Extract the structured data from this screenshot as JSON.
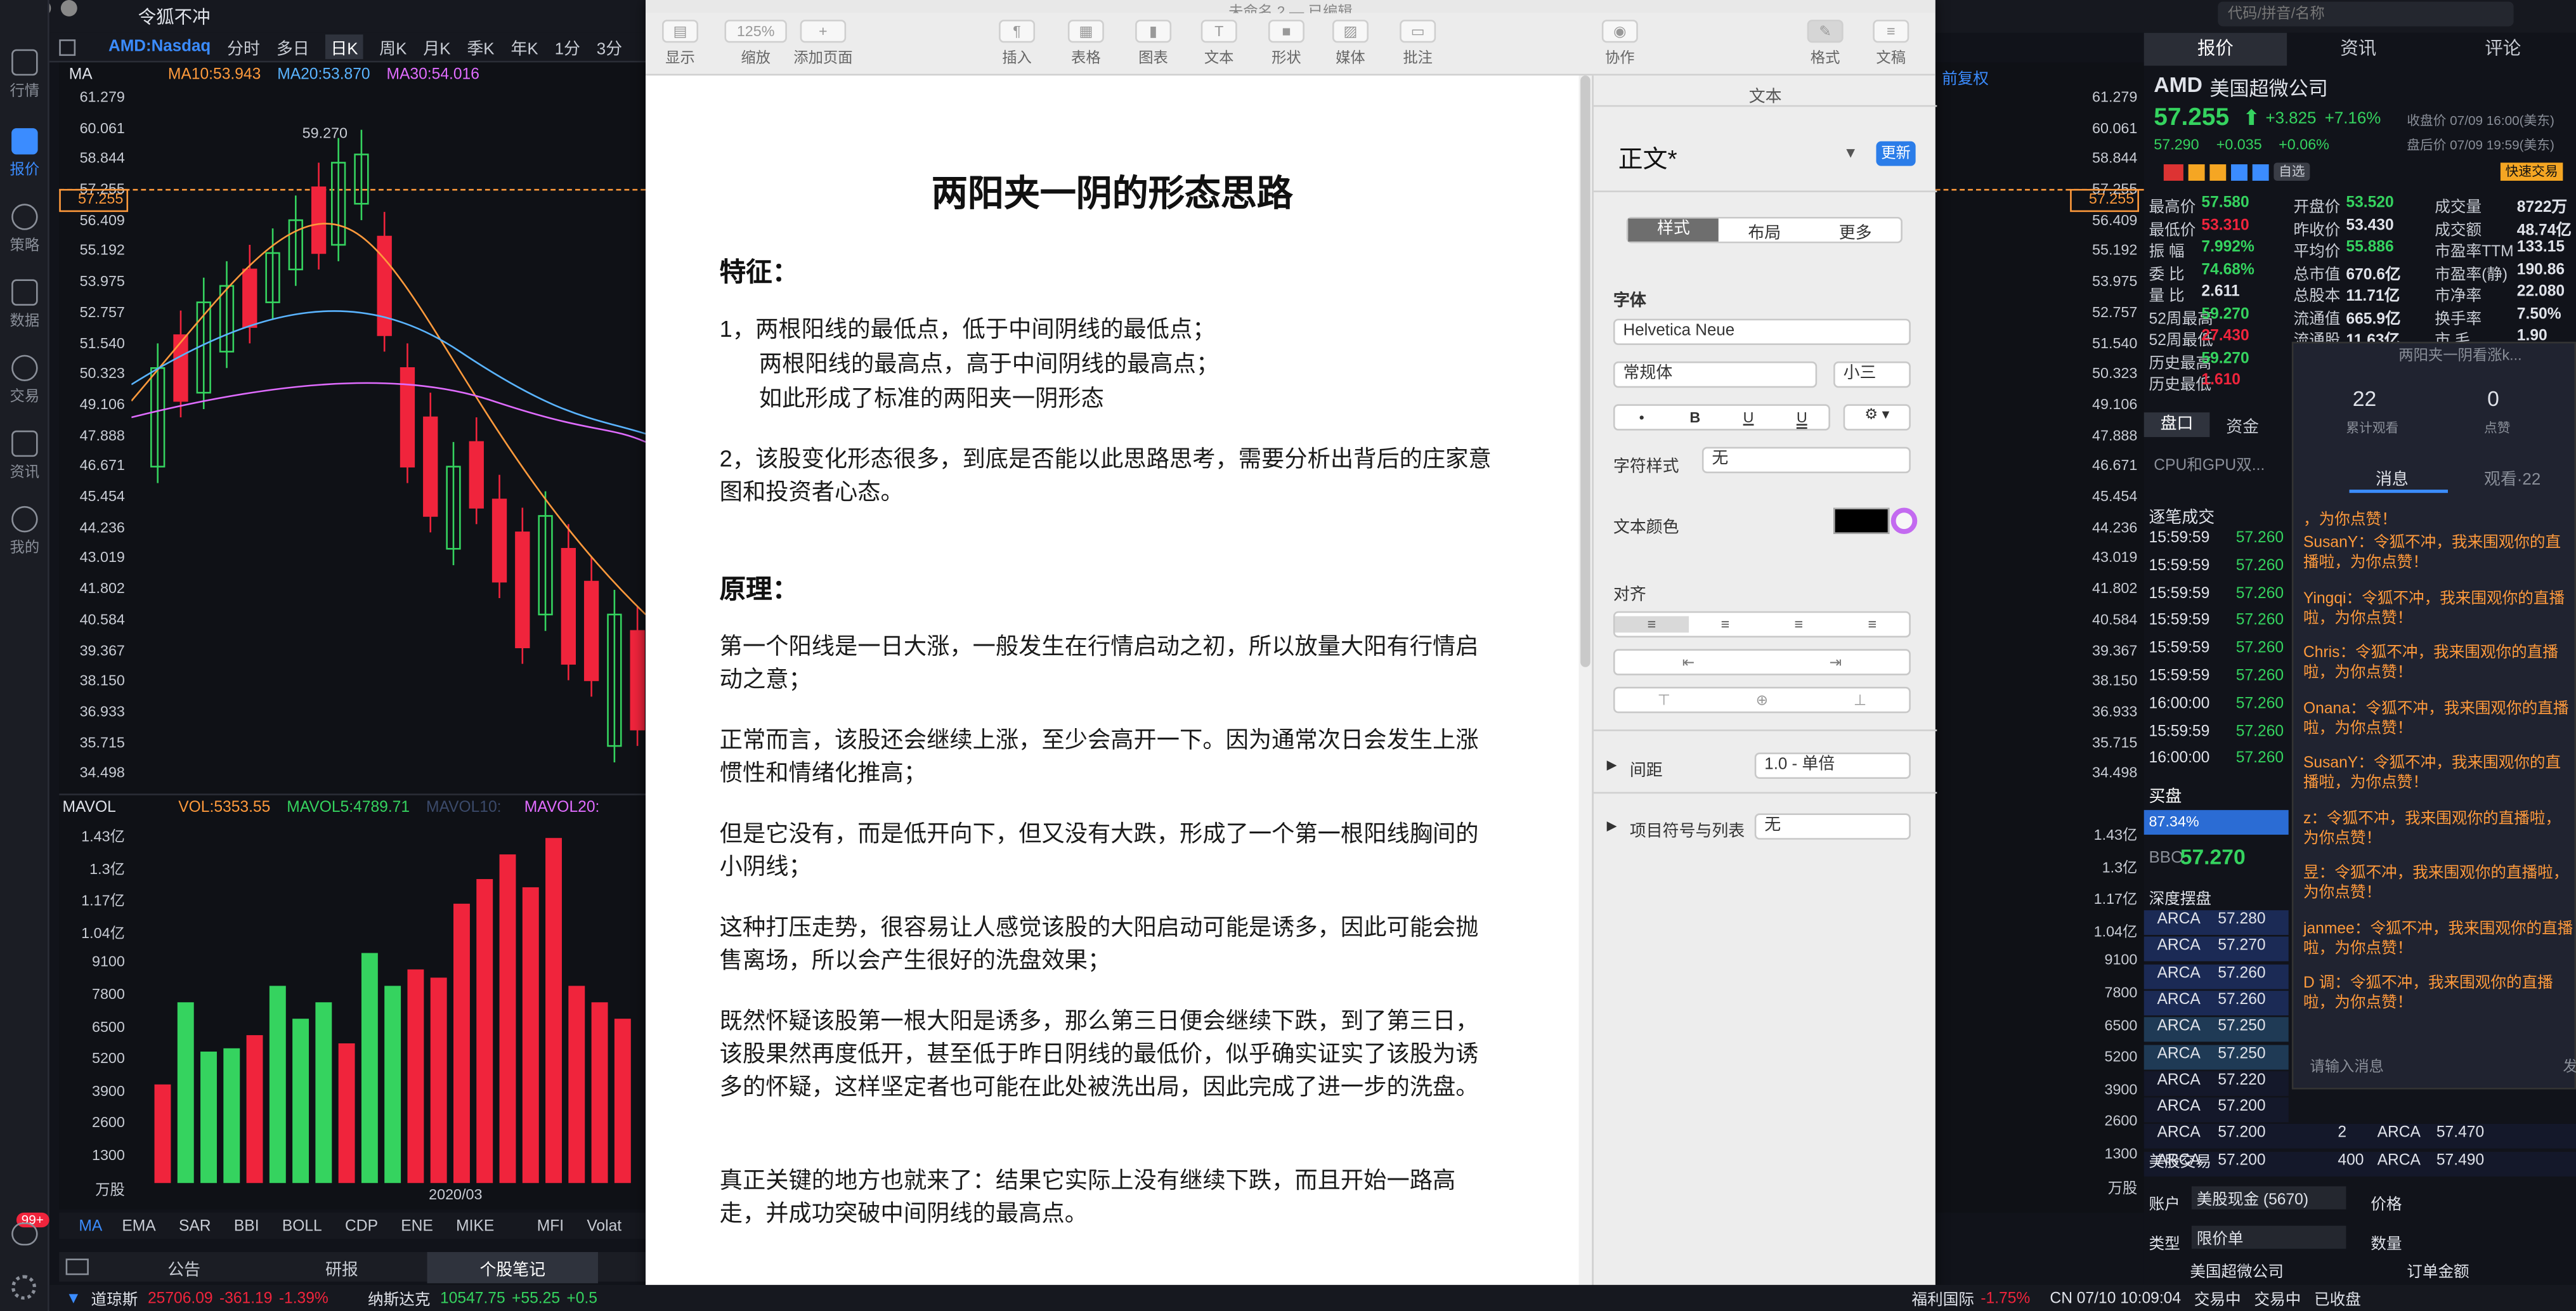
{
  "app": {
    "window_title": "令狐不冲",
    "doc_window_title": "未命名 2 — 已编辑",
    "search_placeholder": "代码/拼音/名称"
  },
  "rail": [
    {
      "label": "行情",
      "icon": "chart-icon"
    },
    {
      "label": "报价",
      "icon": "quote-icon"
    },
    {
      "label": "策略",
      "icon": "strategy-icon"
    },
    {
      "label": "数据",
      "icon": "database-icon"
    },
    {
      "label": "交易",
      "icon": "trade-icon"
    },
    {
      "label": "资讯",
      "icon": "news-icon"
    },
    {
      "label": "我的",
      "icon": "user-icon"
    }
  ],
  "rail_badge": "99+",
  "periods": [
    "AMD:Nasdaq",
    "分时",
    "多日",
    "日K",
    "周K",
    "月K",
    "季K",
    "年K",
    "1分",
    "3分"
  ],
  "ma_line": {
    "label": "MA",
    "ma10": "MA10:53.943",
    "ma20": "MA20:53.870",
    "ma30": "MA30:54.016"
  },
  "y_axis": [
    "61.279",
    "60.061",
    "58.844",
    "57.255",
    "56.409",
    "55.192",
    "53.975",
    "52.757",
    "51.540",
    "50.323",
    "49.106",
    "47.888",
    "46.671",
    "45.454",
    "44.236",
    "43.019",
    "41.802",
    "40.584",
    "39.367",
    "38.150",
    "36.933",
    "35.715",
    "34.498"
  ],
  "peak_label": "59.270",
  "vol_line": {
    "label": "MAVOL",
    "vol": "VOL:5353.55",
    "mavol5": "MAVOL5:4789.71",
    "mavol10": "MAVOL10:",
    "mavol20": "MAVOL20:"
  },
  "vol_axis": [
    "1.43亿",
    "1.3亿",
    "1.17亿",
    "1.04亿",
    "9100",
    "7800",
    "6500",
    "5200",
    "3900",
    "2600",
    "1300",
    "万股"
  ],
  "date_label": "2020/03",
  "indicators": [
    "MA",
    "EMA",
    "SAR",
    "BBI",
    "BOLL",
    "CDP",
    "ENE",
    "MIKE",
    "MFI",
    "Volat"
  ],
  "bottom_tabs": [
    "公告",
    "研报",
    "个股笔记"
  ],
  "toolbar": {
    "display": "显示",
    "zoom_value": "125%",
    "zoom": "缩放",
    "add_page": "添加页面",
    "insert": "插入",
    "table": "表格",
    "chart": "图表",
    "text": "文本",
    "shape": "形状",
    "media": "媒体",
    "comment": "批注",
    "collaborate": "协作",
    "format": "格式",
    "document": "文稿"
  },
  "doc": {
    "title": "两阳夹一阴的形态思路",
    "h_features": "特征：",
    "f1a": "1，两根阳线的最低点，低于中间阴线的最低点；",
    "f1b": "两根阳线的最高点，高于中间阴线的最高点；",
    "f1c": "如此形成了标准的两阳夹一阴形态",
    "f2": "2，该股变化形态很多，到底是否能以此思路思考，需要分析出背后的庄家意图和投资者心态。",
    "h_principle": "原理：",
    "p1": "第一个阳线是一日大涨，一般发生在行情启动之初，所以放量大阳有行情启动之意；",
    "p2": "正常而言，该股还会继续上涨，至少会高开一下。因为通常次日会发生上涨惯性和情绪化推高；",
    "p3": "但是它没有，而是低开向下，但又没有大跌，形成了一个第一根阳线胸间的小阴线；",
    "p4": "这种打压走势，很容易让人感觉该股的大阳启动可能是诱多，因此可能会抛售离场，所以会产生很好的洗盘效果；",
    "p5": "既然怀疑该股第一根大阳是诱多，那么第三日便会继续下跌，到了第三日，该股果然再度低开，甚至低于昨日阴线的最低价，似乎确实证实了该股为诱多的怀疑，这样坚定者也可能在此处被洗出局，因此完成了进一步的洗盘。",
    "p6": "真正关键的地方也就来了：结果它实际上没有继续下跌，而且开始一路高走，并成功突破中间阴线的最高点。"
  },
  "inspector": {
    "header": "文本",
    "style_name": "正文*",
    "update": "更新",
    "tabs": [
      "样式",
      "布局",
      "更多"
    ],
    "font_label": "字体",
    "font": "Helvetica Neue",
    "weight": "常规体",
    "size": "小三",
    "char_style_label": "字符样式",
    "char_style": "无",
    "text_color_label": "文本颜色",
    "align_label": "对齐",
    "spacing_label": "间距",
    "spacing": "1.0 - 单倍",
    "bullets_label": "项目符号与列表",
    "bullets": "无"
  },
  "stock": {
    "tabs": [
      "报价",
      "资讯",
      "评论"
    ],
    "symbol": "AMD",
    "name": "美国超微公司",
    "price": "57.255",
    "change": "+3.825",
    "change_pct": "+7.16%",
    "close_note": "收盘价 07/09 16:00(美东)",
    "post_price": "57.290",
    "post_change": "+0.035",
    "post_pct": "+0.06%",
    "post_note": "盘后价 07/09 19:59(美东)",
    "watch": "自选",
    "fast_trade": "快速交易",
    "stats": [
      [
        "最高价",
        "57.580",
        "开盘价",
        "53.520",
        "成交量",
        "8722万"
      ],
      [
        "最低价",
        "53.310",
        "昨收价",
        "53.430",
        "成交额",
        "48.74亿"
      ],
      [
        "振 幅",
        "7.992%",
        "平均价",
        "55.886",
        "市盈率TTM",
        "133.15"
      ],
      [
        "委 比",
        "74.68%",
        "总市值",
        "670.6亿",
        "市盈率(静)",
        "190.86"
      ],
      [
        "量 比",
        "2.611",
        "总股本",
        "11.71亿",
        "市净率",
        "22.080"
      ],
      [
        "52周最高",
        "59.270",
        "流通值",
        "665.9亿",
        "换手率",
        "7.50%"
      ],
      [
        "52周最低",
        "27.430",
        "流通股",
        "11.63亿",
        "市 毛",
        "1.90"
      ],
      [
        "历史最高",
        "59.270"
      ],
      [
        "历史最低",
        "1.610"
      ]
    ],
    "sub_tabs": [
      "盘口",
      "资金"
    ],
    "news_line": "CPU和GPU双...",
    "ticks_header": "逐笔成交",
    "ticks": [
      [
        "15:59:59",
        "57.260"
      ],
      [
        "15:59:59",
        "57.260"
      ],
      [
        "15:59:59",
        "57.260"
      ],
      [
        "15:59:59",
        "57.260"
      ],
      [
        "15:59:59",
        "57.260"
      ],
      [
        "15:59:59",
        "57.260"
      ],
      [
        "16:00:00",
        "57.260"
      ],
      [
        "15:59:59",
        "57.260"
      ],
      [
        "16:00:00",
        "57.260"
      ]
    ],
    "bid_label": "买盘",
    "bid_pct": "87.34%",
    "bbo_label": "BBO",
    "bbo": "57.270",
    "depth_header": "深度摆盘",
    "depth": [
      [
        "ARCA",
        "57.280"
      ],
      [
        "ARCA",
        "57.270"
      ],
      [
        "ARCA",
        "57.260"
      ],
      [
        "ARCA",
        "57.260"
      ],
      [
        "ARCA",
        "57.250"
      ],
      [
        "ARCA",
        "57.250"
      ],
      [
        "ARCA",
        "57.220"
      ],
      [
        "ARCA",
        "57.200"
      ],
      [
        "ARCA",
        "57.200",
        "2",
        "ARCA",
        "57.470"
      ],
      [
        "ARCA",
        "57.200",
        "400",
        "ARCA",
        "57.490"
      ]
    ],
    "us_trade": "美股交易",
    "account_label": "账户",
    "account": "美股现金 (5670)",
    "price_label": "价格",
    "type_label": "类型",
    "type": "限价单",
    "qty_label": "数量",
    "footer_name": "美国超微公司",
    "order_amount": "订单金额"
  },
  "chat": {
    "title": "两阳夹一阴看涨k...",
    "views": "22",
    "views_label": "累计观看",
    "likes": "0",
    "likes_label": "点赞",
    "tab_msg": "消息",
    "tab_view": "观看·22",
    "messages": [
      "，为你点赞！",
      "SusanY：令狐不冲，我来围观你的直播啦，为你点赞！",
      "Yingqi：令狐不冲，我来围观你的直播啦，为你点赞！",
      "Chris：令狐不冲，我来围观你的直播啦，为你点赞！",
      "Onana：令狐不冲，我来围观你的直播啦，为你点赞！",
      "SusanY：令狐不冲，我来围观你的直播啦，为你点赞！",
      "z：令狐不冲，我来围观你的直播啦，为你点赞！",
      "昱：令狐不冲，我来围观你的直播啦，为你点赞！",
      "janmee：令狐不冲，我来围观你的直播啦，为你点赞！",
      "D 调：令狐不冲，我来围观你的直播啦，为你点赞！"
    ],
    "input_placeholder": "请输入消息",
    "send": "发"
  },
  "bottombar": {
    "dji_name": "道琼斯",
    "dji": "25706.09",
    "dji_chg": "-361.19",
    "dji_pct": "-1.39%",
    "ndx_name": "纳斯达克",
    "ndx": "10547.75",
    "ndx_chg": "+55.25",
    "ndx_pct": "+0.5",
    "hk_name": "福利国际",
    "hk_chg": "-1.75%",
    "market_time": "CN 07/10 10:09:04",
    "trading": "交易中",
    "trading2": "交易中",
    "closed": "已收盘"
  },
  "colors": {
    "up": "#f0243c",
    "down": "#35d35f",
    "accent": "#3b8cff"
  }
}
